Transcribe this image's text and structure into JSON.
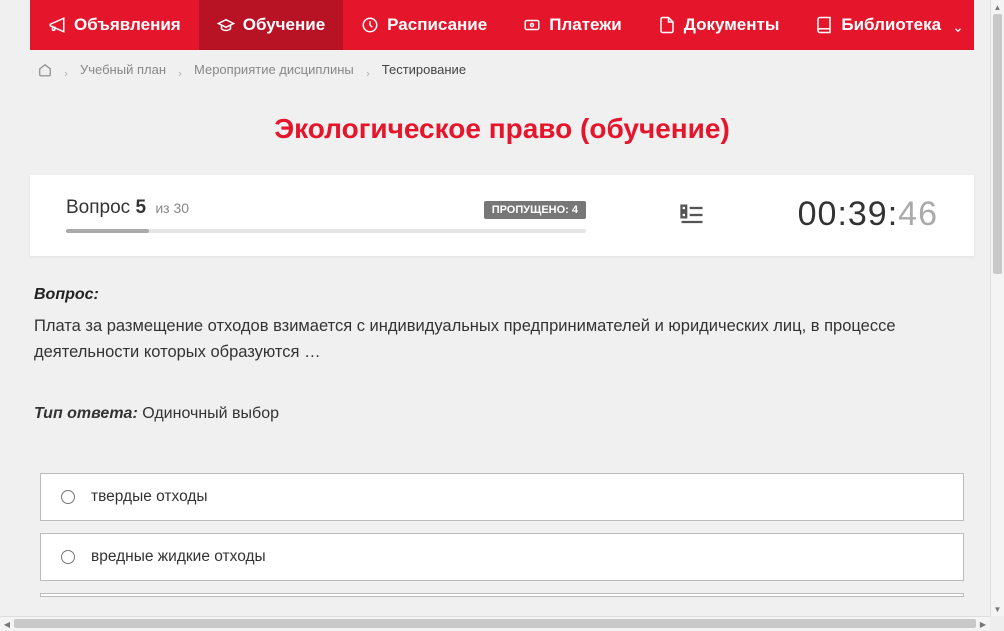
{
  "nav": {
    "items": [
      {
        "label": "Объявления",
        "icon": "megaphone"
      },
      {
        "label": "Обучение",
        "icon": "graduation"
      },
      {
        "label": "Расписание",
        "icon": "clock"
      },
      {
        "label": "Платежи",
        "icon": "payment"
      },
      {
        "label": "Документы",
        "icon": "document"
      },
      {
        "label": "Библиотека",
        "icon": "book",
        "dropdown": true
      }
    ],
    "active_index": 1
  },
  "breadcrumb": {
    "items": [
      "Учебный план",
      "Мероприятие дисциплины"
    ],
    "current": "Тестирование"
  },
  "page_title": "Экологическое право (обучение)",
  "quiz": {
    "question_label_prefix": "Вопрос",
    "question_number": "5",
    "of_prefix": "из",
    "total_questions": "30",
    "skipped_label": "ПРОПУЩЕНО: 4",
    "progress_percent": 16,
    "timer_main": "00:39:",
    "timer_sec": "46"
  },
  "question": {
    "label": "Вопрос:",
    "text": "Плата за размещение отходов взимается с индивидуальных предпринимателей и юридических лиц, в процессе деятельности которых образуются …"
  },
  "answer_type": {
    "label": "Тип ответа:",
    "value": "Одиночный выбор"
  },
  "options": [
    {
      "text": "твердые отходы"
    },
    {
      "text": "вредные жидкие отходы"
    }
  ]
}
